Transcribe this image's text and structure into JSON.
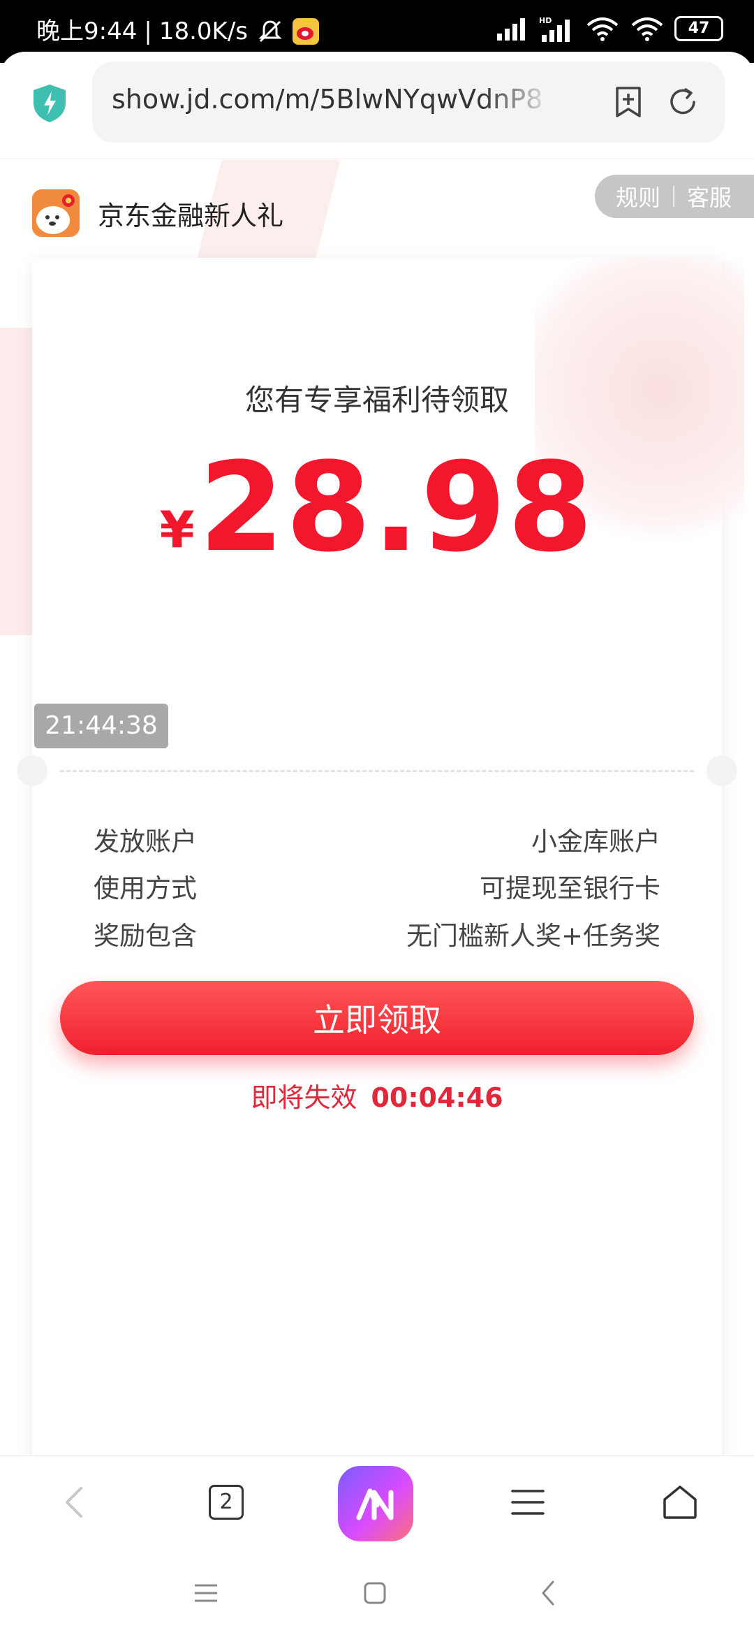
{
  "status_bar": {
    "time": "晚上9:44",
    "speed": "18.0K/s",
    "battery": "47"
  },
  "browser": {
    "url": "show.jd.com/m/5BlwNYqwVdnP8"
  },
  "page": {
    "brand_name": "京东金融新人礼",
    "rules_label": "规则",
    "service_label": "客服",
    "headline": "您有专享福利待领取",
    "currency": "¥",
    "amount": "28.98",
    "time_badge": "21:44:38",
    "details": [
      {
        "label": "发放账户",
        "value": "小金库账户"
      },
      {
        "label": "使用方式",
        "value": "可提现至银行卡"
      },
      {
        "label": "奖励包含",
        "value": "无门槛新人奖+任务奖"
      }
    ],
    "cta_label": "立即领取",
    "expire_label": "即将失效",
    "countdown": "00:04:46"
  },
  "bottom_nav": {
    "tab_count": "2"
  },
  "colors": {
    "accent": "#f2172d",
    "button": "#f0202d"
  }
}
